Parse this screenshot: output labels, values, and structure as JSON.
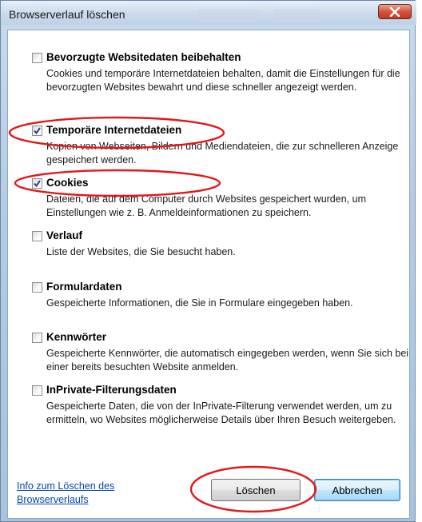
{
  "window": {
    "title": "Browserverlauf löschen",
    "close_icon": "close-x-icon"
  },
  "options": [
    {
      "label": "Bevorzugte Websitedaten beibehalten",
      "description": "Cookies und temporäre Internetdateien behalten, damit die Einstellungen für die bevorzugten Websites bewahrt und diese schneller angezeigt werden.",
      "checked": false
    },
    {
      "label": "Temporäre Internetdateien",
      "description": "Kopien von Webseiten, Bildern und Mediendateien, die zur schnelleren Anzeige gespeichert werden.",
      "checked": true
    },
    {
      "label": "Cookies",
      "description": "Dateien, die auf dem Computer durch Websites gespeichert wurden, um Einstellungen wie z. B. Anmeldeinformationen zu speichern.",
      "checked": true
    },
    {
      "label": "Verlauf",
      "description": "Liste der Websites, die Sie besucht haben.",
      "checked": false
    },
    {
      "label": "Formulardaten",
      "description": "Gespeicherte Informationen, die Sie in Formulare eingegeben haben.",
      "checked": false
    },
    {
      "label": "Kennwörter",
      "description": "Gespeicherte Kennwörter, die automatisch eingegeben werden, wenn Sie sich bei einer bereits besuchten Website anmelden.",
      "checked": false
    },
    {
      "label": "InPrivate-Filterungsdaten",
      "description": "Gespeicherte Daten, die von der InPrivate-Filterung verwendet werden, um zu ermitteln, wo Websites möglicherweise Details über Ihren Besuch weitergeben.",
      "checked": false
    }
  ],
  "footer": {
    "info_link": "Info zum Löschen des Browserverlaufs",
    "delete_button": "Löschen",
    "cancel_button": "Abbrechen"
  },
  "colors": {
    "annotation_red": "#e0191b",
    "link_blue": "#0645ad"
  }
}
